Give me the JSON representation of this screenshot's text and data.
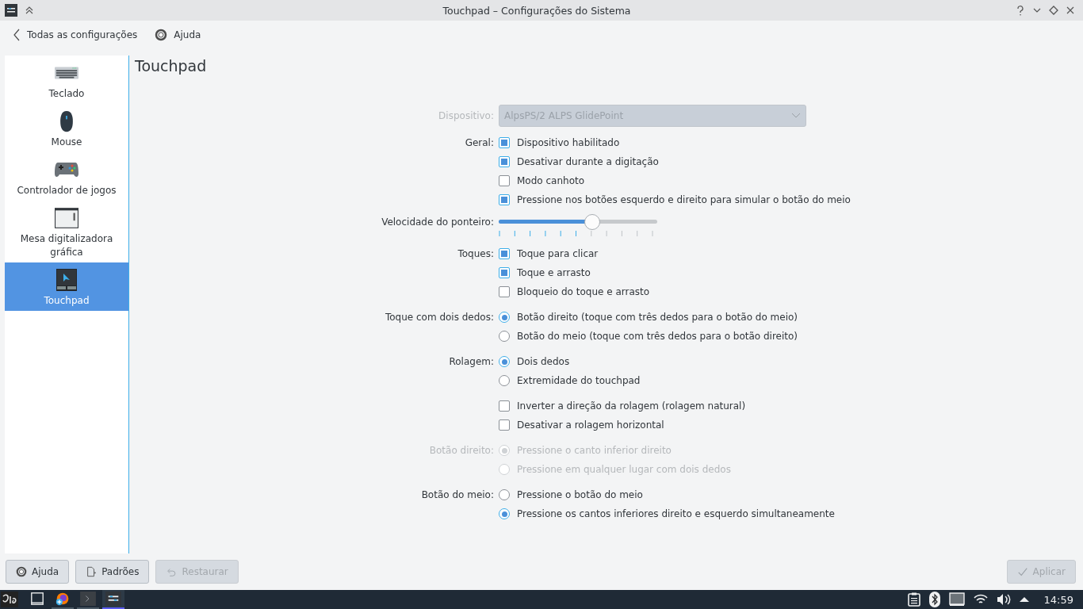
{
  "window": {
    "title": "Touchpad – Configurações do Sistema"
  },
  "toolbar": {
    "back": "Todas as configurações",
    "help": "Ajuda"
  },
  "sidebar": {
    "items": [
      {
        "label": "Teclado",
        "kind": "keyboard",
        "selected": false
      },
      {
        "label": "Mouse",
        "kind": "mouse",
        "selected": false
      },
      {
        "label": "Controlador de jogos",
        "kind": "gamepad",
        "selected": false
      },
      {
        "label": "Mesa digitalizadora gráfica",
        "kind": "tablet",
        "selected": false
      },
      {
        "label": "Touchpad",
        "kind": "touchpad",
        "selected": true
      }
    ]
  },
  "page": {
    "title": "Touchpad",
    "rows": [
      {
        "kind": "combo",
        "label": "Dispositivo:",
        "value": "AlpsPS/2 ALPS GlidePoint",
        "disabled": true
      },
      {
        "kind": "checks",
        "label": "Geral:",
        "disabled": false,
        "options": [
          {
            "label": "Dispositivo habilitado",
            "checked": true
          },
          {
            "label": "Desativar durante a digitação",
            "checked": true
          },
          {
            "label": "Modo canhoto",
            "checked": false
          },
          {
            "label": "Pressione nos botões esquerdo e direito para simular o botão do meio",
            "checked": true
          }
        ]
      },
      {
        "kind": "slider",
        "label": "Velocidade do ponteiro:",
        "level": 0.59,
        "disabled": false
      },
      {
        "kind": "checks",
        "label": "Toques:",
        "disabled": false,
        "options": [
          {
            "label": "Toque para clicar",
            "checked": true
          },
          {
            "label": "Toque e arrasto",
            "checked": true
          },
          {
            "label": "Bloqueio do toque e arrasto",
            "checked": false
          }
        ]
      },
      {
        "kind": "radios",
        "label": "Toque com dois dedos:",
        "disabled": false,
        "options": [
          {
            "label": "Botão direito (toque com três dedos para o botão do meio)",
            "selected": true
          },
          {
            "label": "Botão do meio (toque com três dedos para o botão direito)",
            "selected": false
          }
        ]
      },
      {
        "kind": "radios",
        "label": "Rolagem:",
        "disabled": false,
        "options": [
          {
            "label": "Dois dedos",
            "selected": true
          },
          {
            "label": "Extremidade do touchpad",
            "selected": false
          }
        ]
      },
      {
        "kind": "checks",
        "label": "",
        "disabled": false,
        "options": [
          {
            "label": "Inverter a direção da rolagem (rolagem natural)",
            "checked": false
          },
          {
            "label": "Desativar a rolagem horizontal",
            "checked": false
          }
        ]
      },
      {
        "kind": "radios",
        "label": "Botão direito:",
        "disabled": true,
        "options": [
          {
            "label": "Pressione o canto inferior direito",
            "selected": true
          },
          {
            "label": "Pressione em qualquer lugar com dois dedos",
            "selected": false
          }
        ]
      },
      {
        "kind": "radios",
        "label": "Botão do meio:",
        "disabled": false,
        "options": [
          {
            "label": "Pressione o botão do meio",
            "selected": false
          },
          {
            "label": "Pressione os cantos inferiores direito e esquerdo simultaneamente",
            "selected": true
          }
        ]
      }
    ]
  },
  "buttons": [
    {
      "label": "Ajuda",
      "kind": "help",
      "disabled": false
    },
    {
      "label": "Padrões",
      "kind": "defaults",
      "disabled": false
    },
    {
      "label": "Restaurar",
      "kind": "undo",
      "disabled": true
    },
    {
      "label": "Aplicar",
      "kind": "check",
      "disabled": true
    }
  ],
  "taskbar": {
    "tasks": [
      {
        "kind": "desktop",
        "active": false
      },
      {
        "kind": "firefox",
        "active": false
      },
      {
        "kind": "terminal",
        "active": false
      },
      {
        "kind": "settings",
        "active": true
      }
    ],
    "clock": "14:59"
  }
}
